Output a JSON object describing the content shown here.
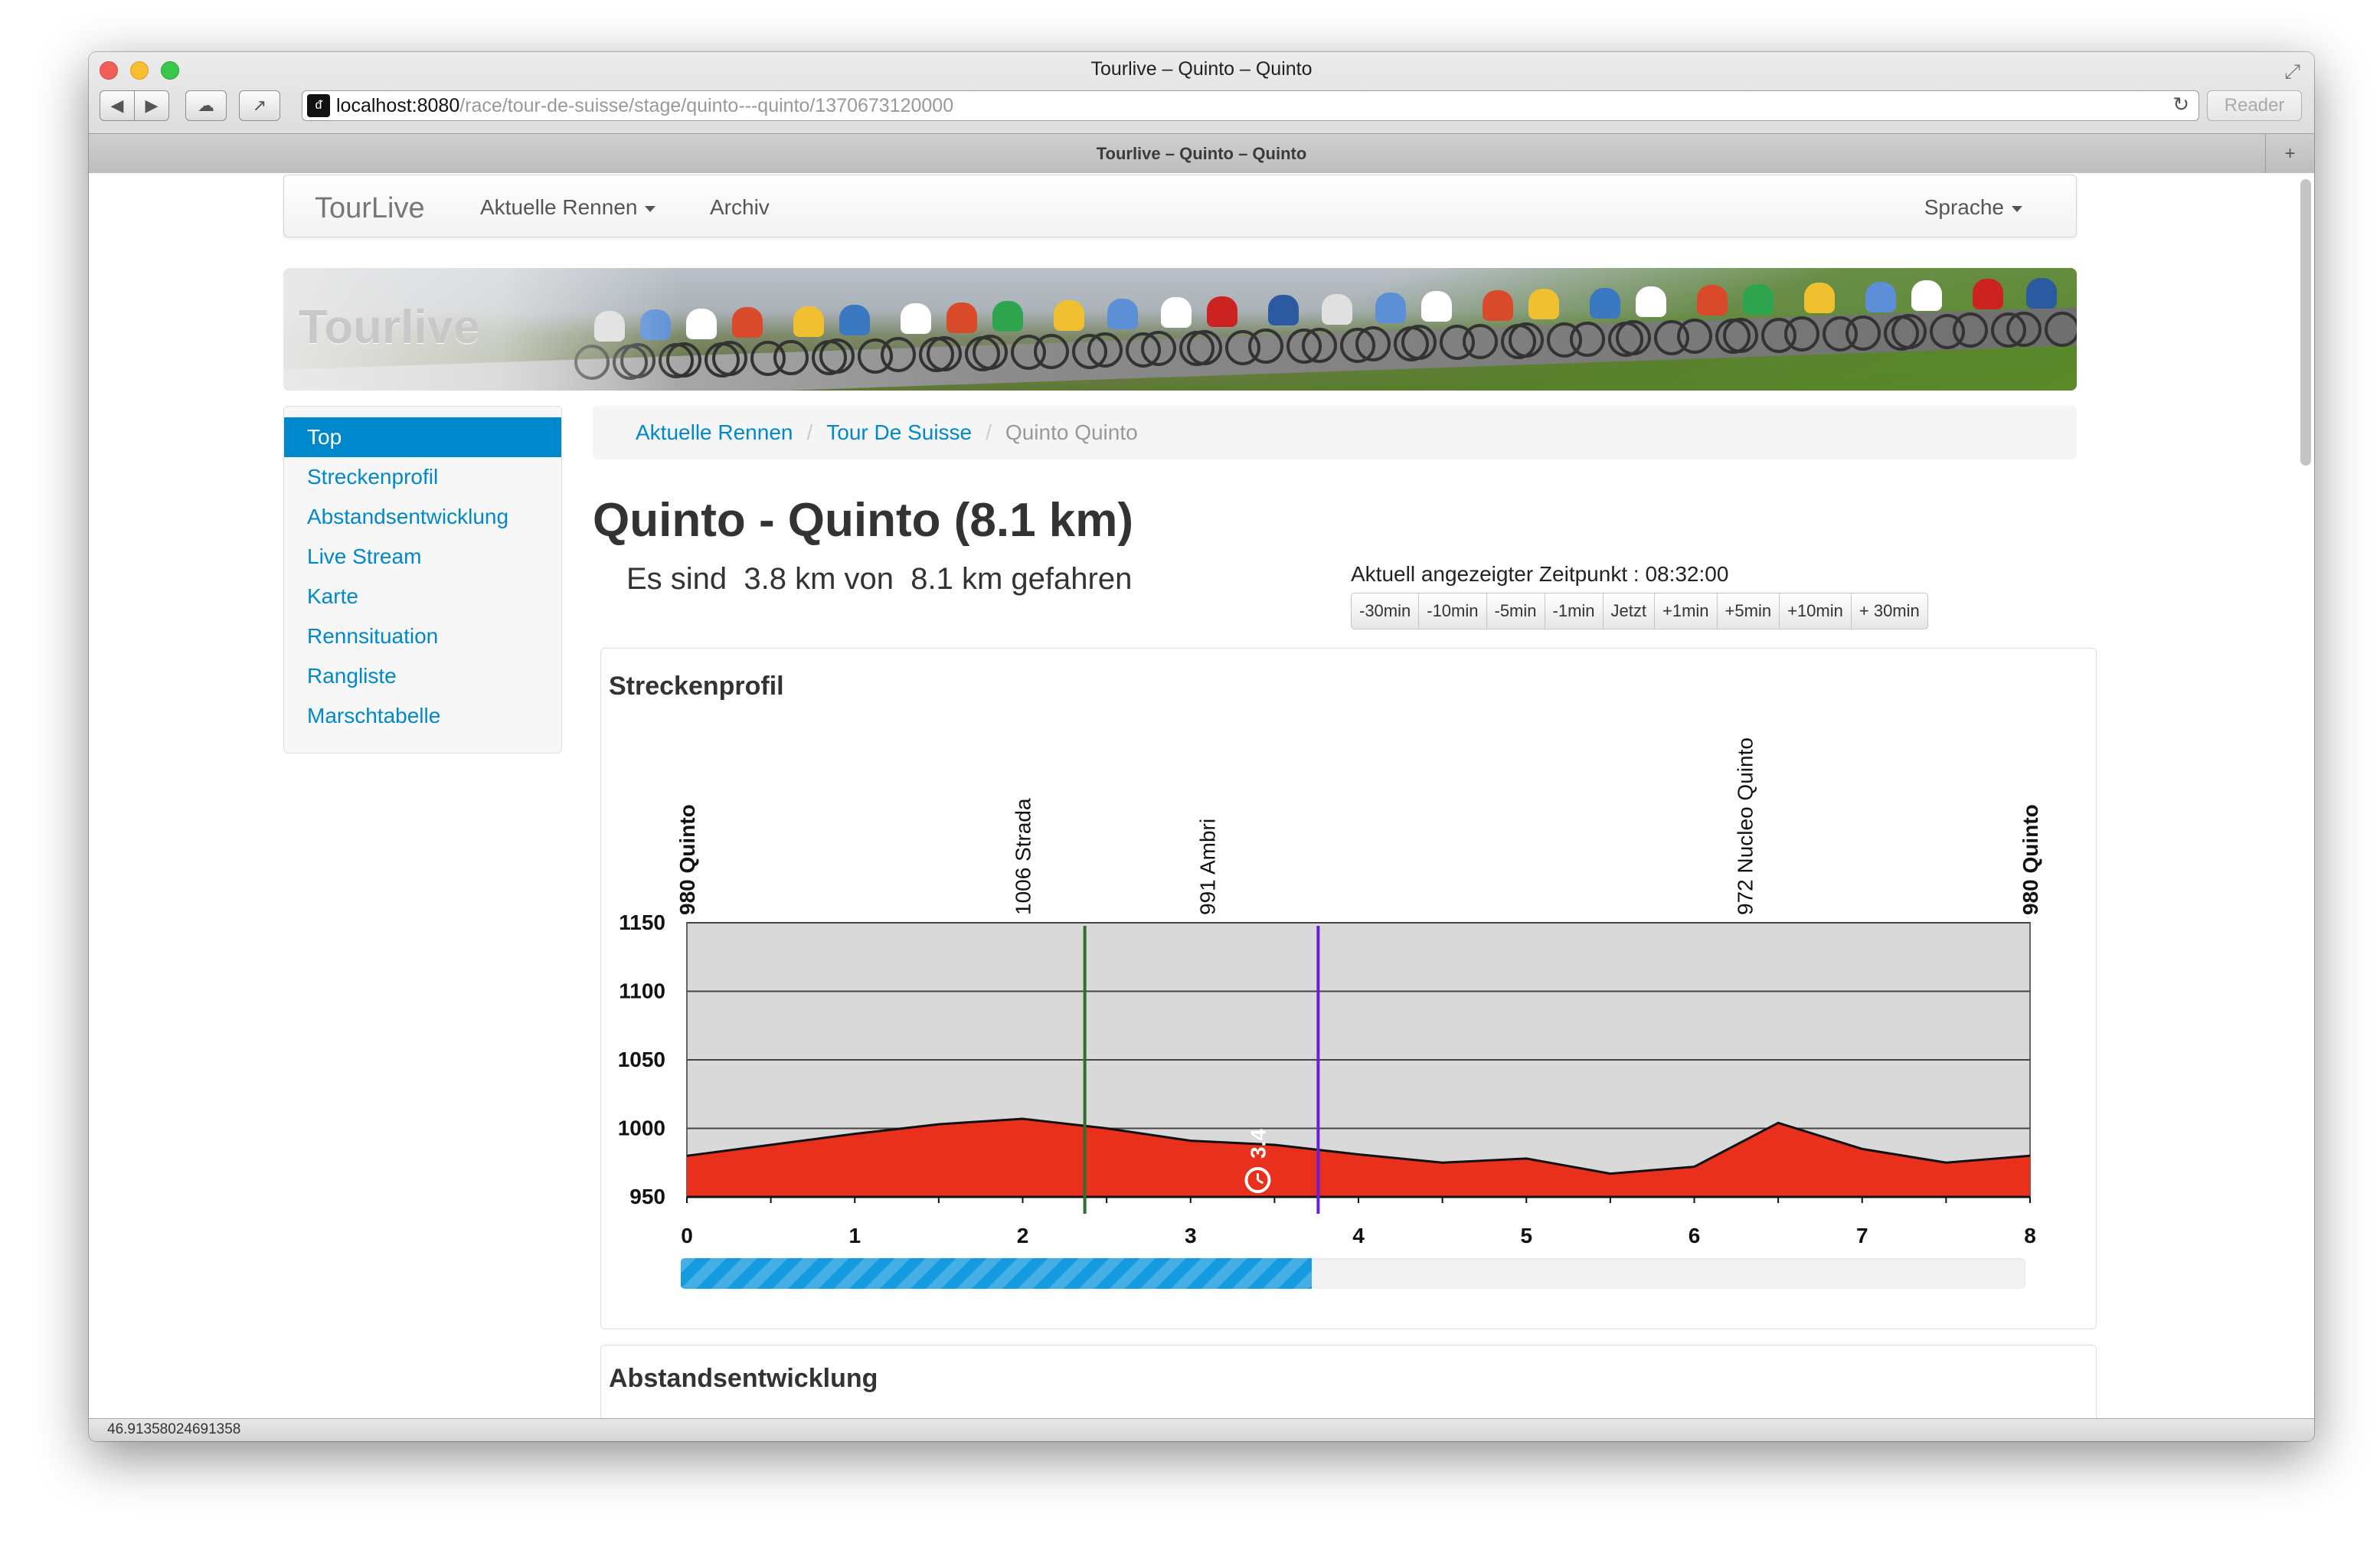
{
  "browser": {
    "window_title": "Tourlive – Quinto – Quinto",
    "tab_title": "Tourlive – Quinto – Quinto",
    "url_host": "localhost:8080",
    "url_path": "/race/tour-de-suisse/stage/quinto---quinto/1370673120000",
    "reader_label": "Reader",
    "status_text": "46.91358024691358",
    "favicon_text": "ᵭ"
  },
  "navbar": {
    "brand": "TourLive",
    "aktuelle_rennen": "Aktuelle Rennen",
    "archiv": "Archiv",
    "sprache": "Sprache"
  },
  "banner": {
    "title": "Tourlive"
  },
  "sidenav": {
    "items": [
      {
        "label": "Top",
        "active": true
      },
      {
        "label": "Streckenprofil"
      },
      {
        "label": "Abstandsentwicklung"
      },
      {
        "label": "Live Stream"
      },
      {
        "label": "Karte"
      },
      {
        "label": "Rennsituation"
      },
      {
        "label": "Rangliste"
      },
      {
        "label": "Marschtabelle"
      }
    ]
  },
  "breadcrumb": {
    "items": [
      "Aktuelle Rennen",
      "Tour De Suisse",
      "Quinto Quinto"
    ],
    "separator": "/"
  },
  "page": {
    "title": "Quinto - Quinto (8.1 km)",
    "progress_text": "Es sind  3.8 km von  8.1 km gefahren",
    "zeitpunkt_label": "Aktuell angezeigter Zeitpunkt : 08:32:00"
  },
  "time_buttons": [
    "-30min",
    "-10min",
    "-5min",
    "-1min",
    "Jetzt",
    "+1min",
    "+5min",
    "+10min",
    "+ 30min"
  ],
  "profile": {
    "heading": "Streckenprofil",
    "progress_fraction": 0.469
  },
  "abstand": {
    "heading": "Abstandsentwicklung"
  },
  "chart_data": {
    "type": "area",
    "title": "Streckenprofil",
    "xlabel": "",
    "ylabel": "",
    "xlim": [
      0,
      8
    ],
    "ylim": [
      950,
      1150
    ],
    "x_ticks": [
      0,
      1,
      2,
      3,
      4,
      5,
      6,
      7,
      8
    ],
    "y_ticks": [
      950,
      1000,
      1050,
      1100,
      1150
    ],
    "grid": true,
    "fill_color": "#e8301c",
    "plot_background": "#d9d9d9",
    "series": [
      {
        "x": [
          0,
          0.5,
          1,
          1.5,
          2,
          2.5,
          3,
          3.5,
          4,
          4.5,
          5,
          5.5,
          6,
          6.5,
          7,
          7.5,
          8
        ],
        "values": [
          980,
          988,
          996,
          1003,
          1007,
          1000,
          991,
          988,
          981,
          975,
          978,
          967,
          972,
          1004,
          985,
          975,
          980
        ]
      }
    ],
    "waypoints": [
      {
        "km": 0,
        "label": "980 Quinto",
        "bold": true
      },
      {
        "km": 2,
        "label": "1006 Strada",
        "bold": false
      },
      {
        "km": 3.1,
        "label": "991 Ambri",
        "bold": false
      },
      {
        "km": 6.3,
        "label": "972 Nucleo Quinto",
        "bold": false
      },
      {
        "km": 8,
        "label": "980 Quinto",
        "bold": true
      }
    ],
    "markers": [
      {
        "km": 2.37,
        "color": "#2e6e2e"
      },
      {
        "km": 3.76,
        "color": "#6a1fd6"
      }
    ],
    "rider_marker": {
      "km": 3.4,
      "label": "3.4"
    }
  }
}
